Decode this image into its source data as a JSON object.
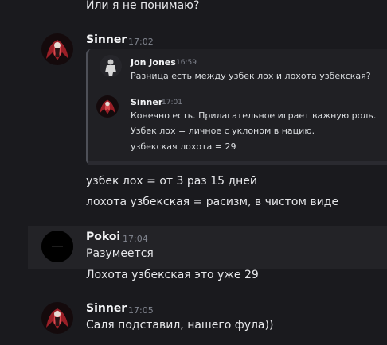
{
  "top_line": "Или я не понимаю?",
  "messages": [
    {
      "author": "Sinner",
      "time": "17:02",
      "quote": {
        "first": {
          "author": "Jon Jones",
          "time": "16:59",
          "text": "Разница есть между узбек лох и лохота узбекская?"
        },
        "second": {
          "author": "Sinner",
          "time": "17:01",
          "lines": [
            "Конечно есть. Прилагательное играет важную роль.",
            "Узбек лох = личное с уклоном в нацию.",
            "узбекская лохота = 29"
          ]
        }
      },
      "lines": [
        "узбек лох  = от 3 раз 15 дней",
        "лохота узбекская = расизм, в чистом виде"
      ]
    },
    {
      "author": "Pokoi",
      "time": "17:04",
      "lines": [
        "Разумеется",
        "Лохота узбекская это уже 29"
      ]
    },
    {
      "author": "Sinner",
      "time": "17:05",
      "lines": [
        "Саля подставил, нашего фула))"
      ]
    }
  ]
}
